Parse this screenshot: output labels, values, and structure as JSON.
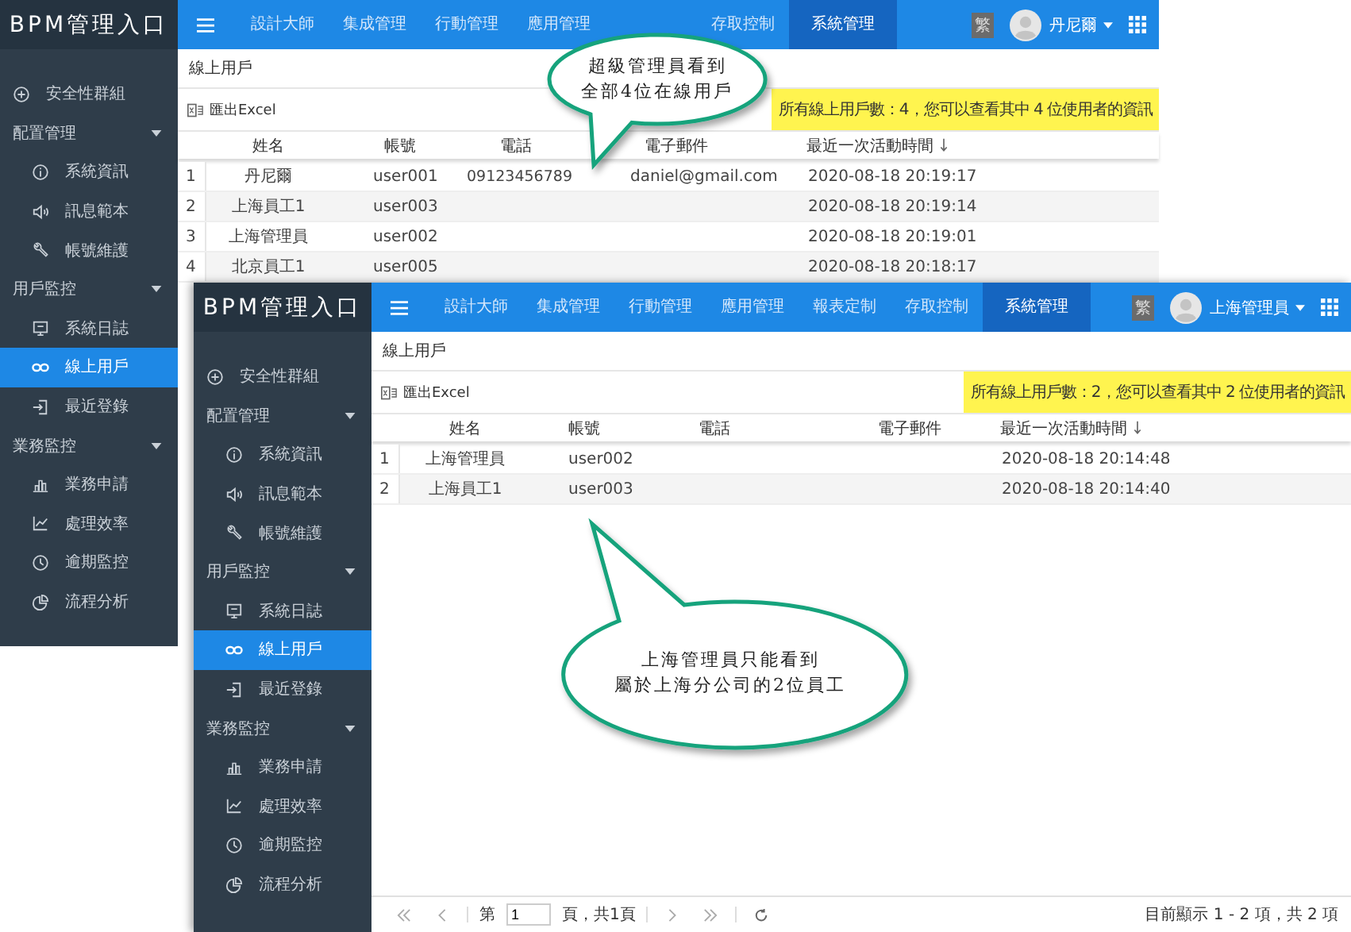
{
  "windows": [
    {
      "brand": "BPM管理入口",
      "nav": [
        {
          "label": "設計大師",
          "selected": false
        },
        {
          "label": "集成管理",
          "selected": false
        },
        {
          "label": "行動管理",
          "selected": false
        },
        {
          "label": "應用管理",
          "selected": false
        },
        {
          "label": "存取控制",
          "selected": false
        },
        {
          "label": "系統管理",
          "selected": true
        }
      ],
      "lang_badge": "繁",
      "user": "丹尼爾",
      "sidebar": [
        {
          "label": "安全性群組",
          "selected": false
        },
        {
          "label": "配置管理",
          "children": [
            {
              "label": "系統資訊",
              "selected": false
            },
            {
              "label": "訊息範本",
              "selected": false
            },
            {
              "label": "帳號維護",
              "selected": false
            }
          ]
        },
        {
          "label": "用戶監控",
          "children": [
            {
              "label": "系統日誌",
              "selected": false
            },
            {
              "label": "線上用戶",
              "selected": true
            },
            {
              "label": "最近登錄",
              "selected": false
            }
          ]
        },
        {
          "label": "業務監控",
          "children": [
            {
              "label": "業務申請",
              "selected": false
            },
            {
              "label": "處理效率",
              "selected": false
            },
            {
              "label": "逾期監控",
              "selected": false
            },
            {
              "label": "流程分析",
              "selected": false
            }
          ]
        }
      ],
      "breadcrumb": "線上用戶",
      "export": "匯出Excel",
      "notice": "所有線上用戶數：4，您可以查看其中 4 位使用者的資訊",
      "columns": [
        "姓名",
        "帳號",
        "電話",
        "電子郵件",
        "最近一次活動時間"
      ],
      "rows": [
        {
          "index": "1",
          "name": "丹尼爾",
          "account": "user001",
          "phone": "09123456789",
          "email": "daniel@gmail.com",
          "last_active": "2020-08-18 20:19:17"
        },
        {
          "index": "2",
          "name": "上海員工1",
          "account": "user003",
          "last_active": "2020-08-18 20:19:14"
        },
        {
          "index": "3",
          "name": "上海管理員",
          "account": "user002",
          "last_active": "2020-08-18 20:19:01"
        },
        {
          "index": "4",
          "name": "北京員工1",
          "account": "user005",
          "last_active": "2020-08-18 20:18:17"
        }
      ]
    },
    {
      "brand": "BPM管理入口",
      "nav": [
        {
          "label": "設計大師",
          "selected": false
        },
        {
          "label": "集成管理",
          "selected": false
        },
        {
          "label": "行動管理",
          "selected": false
        },
        {
          "label": "應用管理",
          "selected": false
        },
        {
          "label": "報表定制",
          "selected": false
        },
        {
          "label": "存取控制",
          "selected": false
        },
        {
          "label": "系統管理",
          "selected": true
        }
      ],
      "lang_badge": "繁",
      "user": "上海管理員",
      "sidebar": [
        {
          "label": "安全性群組",
          "selected": false
        },
        {
          "label": "配置管理",
          "children": [
            {
              "label": "系統資訊",
              "selected": false
            },
            {
              "label": "訊息範本",
              "selected": false
            },
            {
              "label": "帳號維護",
              "selected": false
            }
          ]
        },
        {
          "label": "用戶監控",
          "children": [
            {
              "label": "系統日誌",
              "selected": false
            },
            {
              "label": "線上用戶",
              "selected": true
            },
            {
              "label": "最近登錄",
              "selected": false
            }
          ]
        },
        {
          "label": "業務監控",
          "children": [
            {
              "label": "業務申請",
              "selected": false
            },
            {
              "label": "處理效率",
              "selected": false
            },
            {
              "label": "逾期監控",
              "selected": false
            },
            {
              "label": "流程分析",
              "selected": false
            }
          ]
        }
      ],
      "breadcrumb": "線上用戶",
      "export": "匯出Excel",
      "notice": "所有線上用戶數：2，您可以查看其中 2 位使用者的資訊",
      "columns": [
        "姓名",
        "帳號",
        "電話",
        "電子郵件",
        "最近一次活動時間"
      ],
      "rows": [
        {
          "index": "1",
          "name": "上海管理員",
          "account": "user002",
          "last_active": "2020-08-18 20:14:48"
        },
        {
          "index": "2",
          "name": "上海員工1",
          "account": "user003",
          "last_active": "2020-08-18 20:14:40"
        }
      ],
      "pager": {
        "page_prefix": "第",
        "page": "1",
        "page_suffix": "頁，共1頁",
        "summary": "目前顯示 1 - 2 項，共 2 項"
      }
    }
  ],
  "callouts": [
    {
      "lines": [
        "超級管理員看到",
        "全部4位在線用戶"
      ]
    },
    {
      "lines": [
        "上海管理員只能看到",
        "屬於上海分公司的2位員工"
      ]
    }
  ]
}
